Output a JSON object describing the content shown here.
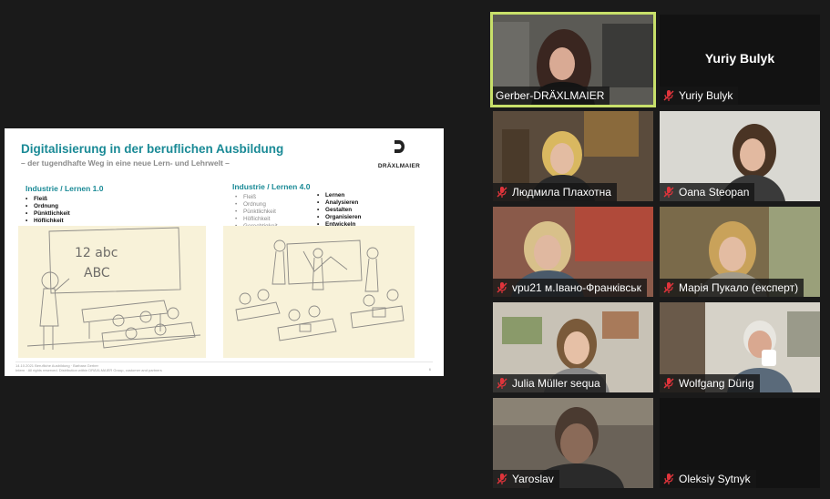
{
  "slide": {
    "title": "Digitalisierung in der beruflichen Ausbildung",
    "subtitle": "– der tugendhafte Weg in eine neue Lern- und Lehrwelt –",
    "logo_text": "DRÄXLMAIER",
    "col1_heading": "Industrie  / Lernen 1.0",
    "col1_items": [
      "Fleiß",
      "Ordnung",
      "Pünktlichkeit",
      "Höflichkeit"
    ],
    "col2_heading": "Industrie  / Lernen 4.0",
    "col2_items_grey": [
      "Fleiß",
      "Ordnung",
      "Pünktlichkeit",
      "Höflichkeit",
      "Gerechtigkeit",
      "Pflichtbewusstsein",
      "Zuverlässigkeit",
      "Durchhaltevermögen",
      "...",
      "..."
    ],
    "col2_items_bold": [
      "Lernen",
      "Analysieren",
      "Gestalten",
      "Organisieren",
      "Entwickeln",
      "Überzeugen",
      "Durchsetzen"
    ],
    "board_text_1": "12 abc",
    "board_text_2": "ABC",
    "footer_line1": "14.10.2021 Berufliche Ausbildung · Barbara Gerber",
    "footer_line2": "Intern · All rights reserved. Distribution within DRÄXLMAIER Group, customer and partners",
    "page_number": "6"
  },
  "participants": [
    {
      "name": "Gerber-DRÄXLMAIER",
      "muted": false,
      "active": true
    },
    {
      "name": "Yuriy Bulyk",
      "big_label": "Yuriy Bulyk",
      "muted": true
    },
    {
      "name": "Людмила Плахотна",
      "muted": true
    },
    {
      "name": "Oana Steopan",
      "muted": true
    },
    {
      "name": "vpu21 м.Івано-Франківськ",
      "muted": true
    },
    {
      "name": "Марія Пукало (експерт)",
      "muted": true
    },
    {
      "name": "Julia Müller sequa",
      "muted": true
    },
    {
      "name": "Wolfgang Dürig",
      "muted": true
    },
    {
      "name": "Yaroslav",
      "muted": true
    },
    {
      "name": "Oleksiy Sytnyk",
      "muted": true
    }
  ],
  "icons": {
    "muted_mic": "mic-off-icon",
    "mic": "mic-icon"
  },
  "colors": {
    "accent": "#1a8a96",
    "active_border": "#c8e06a",
    "muted": "#e0343b"
  }
}
